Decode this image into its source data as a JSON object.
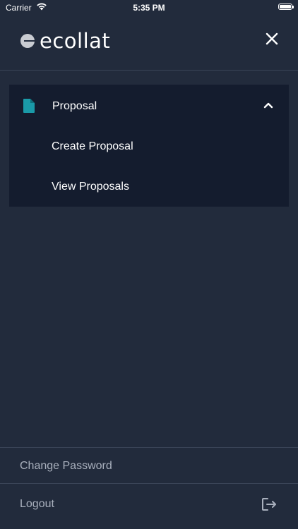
{
  "status_bar": {
    "carrier": "Carrier",
    "time": "5:35 PM"
  },
  "header": {
    "logo_text": "ecollat"
  },
  "menu": {
    "group_title": "Proposal",
    "items": [
      {
        "label": "Create Proposal"
      },
      {
        "label": "View Proposals"
      }
    ]
  },
  "footer": {
    "change_password": "Change Password",
    "logout": "Logout"
  },
  "colors": {
    "background": "#222b3c",
    "menu_background": "#141c2e",
    "accent_teal": "#1a9aa8",
    "muted_text": "#a9b0bd"
  },
  "icons": {
    "wifi": "wifi-icon",
    "battery": "battery-icon",
    "close": "close-icon",
    "document": "document-icon",
    "chevron": "chevron-up-icon",
    "logout": "logout-icon"
  }
}
